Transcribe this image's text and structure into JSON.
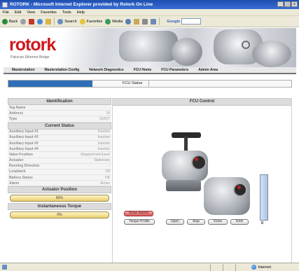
{
  "window": {
    "title": "ROTORK - Microsoft Internet Explorer provided by Rotork On Line",
    "controls": [
      "_",
      "□",
      "×"
    ]
  },
  "menu": [
    "File",
    "Edit",
    "View",
    "Favorites",
    "Tools",
    "Help"
  ],
  "toolbar": {
    "back": "Back",
    "search": "Search",
    "favorites": "Favorites",
    "media": "Media",
    "google": "Google"
  },
  "brand": {
    "logo": "rotork",
    "subtitle": "Pakscan Ethernet Bridge",
    "logo_color": "#d0181e"
  },
  "nav": [
    "Masterstation",
    "Masterstation Config",
    "Network Diagnostics",
    "FCU Home",
    "FCU Parameters",
    "Admin Area"
  ],
  "status_strip": {
    "label": "FCU Status",
    "accent": "#2f6fb8"
  },
  "identification": {
    "heading": "Identification",
    "rows": [
      {
        "key": "Tag Name",
        "value": ""
      },
      {
        "key": "Address",
        "value": "10"
      },
      {
        "key": "Type",
        "value": "IQ/IQT"
      }
    ]
  },
  "current_status": {
    "heading": "Current Status",
    "rows": [
      {
        "key": "Auxiliary Input #1",
        "value": "Inactive"
      },
      {
        "key": "Auxiliary Input #2",
        "value": "Inactive"
      },
      {
        "key": "Auxiliary Input #3",
        "value": "Inactive"
      },
      {
        "key": "Auxiliary Input #4",
        "value": "Inactive"
      },
      {
        "key": "Valve Position",
        "value": "Stopped mid-travel"
      },
      {
        "key": "Actuator",
        "value": "Stationary"
      },
      {
        "key": "Running Direction",
        "value": "-"
      },
      {
        "key": "Loopback",
        "value": "Off"
      },
      {
        "key": "Battery Status",
        "value": "OK"
      },
      {
        "key": "Alarm",
        "value": "Active"
      }
    ]
  },
  "actuator_position": {
    "heading": "Actuator Position",
    "label": "82%",
    "fraction": 0.82
  },
  "instantaneous_torque": {
    "heading": "Instantaneous Torque",
    "label": "0%",
    "fraction": 0
  },
  "fcu_control": {
    "heading": "FCU Control",
    "show_alarms": "Show Alarms",
    "torque_profile": "Torque Profile",
    "open": "Open",
    "stop": "Stop",
    "close": "Close",
    "esd": "ESD",
    "slider_value": "0",
    "slider_fraction": 1.0
  },
  "browser_status": {
    "zone": "Internet"
  }
}
